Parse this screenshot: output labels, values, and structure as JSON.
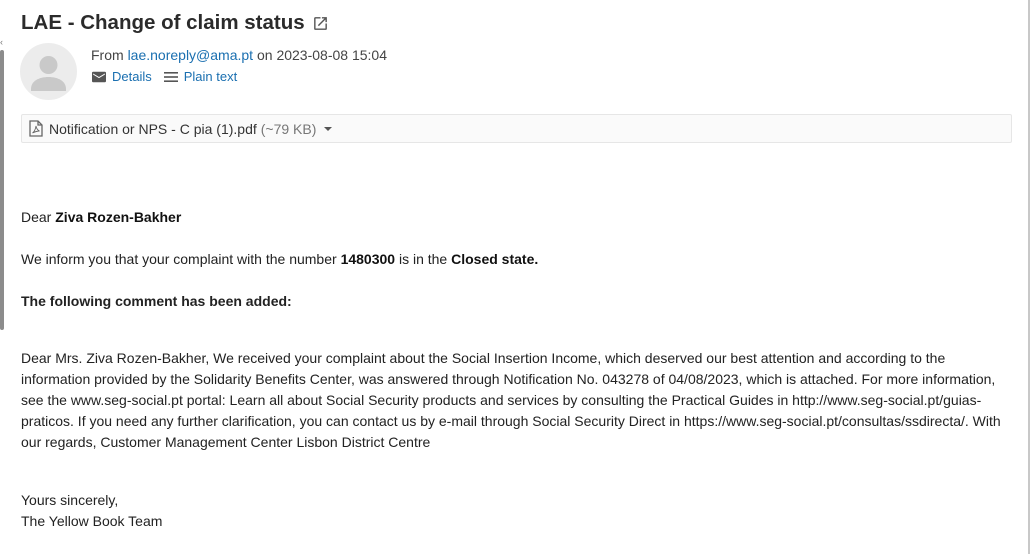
{
  "email": {
    "subject": "LAE - Change of claim status",
    "from_label": "From",
    "from_address": "lae.noreply@ama.pt",
    "on_label": "on",
    "date": "2023-08-08 15:04",
    "actions": {
      "details": "Details",
      "plain_text": "Plain text"
    },
    "attachment": {
      "filename": "Notification or NPS - C pia (1).pdf",
      "size": "(~79 KB)"
    }
  },
  "body": {
    "greeting_prefix": "Dear",
    "recipient_name": "Ziva Rozen-Bakher",
    "inform_prefix": "We inform you that your complaint with the number",
    "complaint_number": "1480300",
    "inform_middle": "is in the",
    "state": "Closed state.",
    "comment_heading": "The following comment has been added:",
    "comment": "Dear Mrs. Ziva Rozen-Bakher, We received your complaint about the Social Insertion Income, which deserved our best attention and according to the information provided by the Solidarity Benefits Center, was answered through Notification No. 043278 of 04/08/2023, which is attached. For more information, see the www.seg-social.pt portal: Learn all about Social Security products and services by consulting the Practical Guides in http://www.seg-social.pt/guias-praticos. If you need any further clarification, you can contact us by e-mail through Social Security Direct in https://www.seg-social.pt/consultas/ssdirecta/. With our regards, Customer Management Center Lisbon District Centre",
    "closing": "Yours sincerely,",
    "signature": "The Yellow Book Team"
  },
  "colors": {
    "link": "#1a6fb0",
    "subject": "#2b2b2b",
    "attachment_bg": "#fafafa"
  },
  "icons": [
    "external-link-icon",
    "avatar-placeholder-icon",
    "envelope-icon",
    "menu-lines-icon",
    "pdf-file-icon",
    "caret-down-icon"
  ]
}
